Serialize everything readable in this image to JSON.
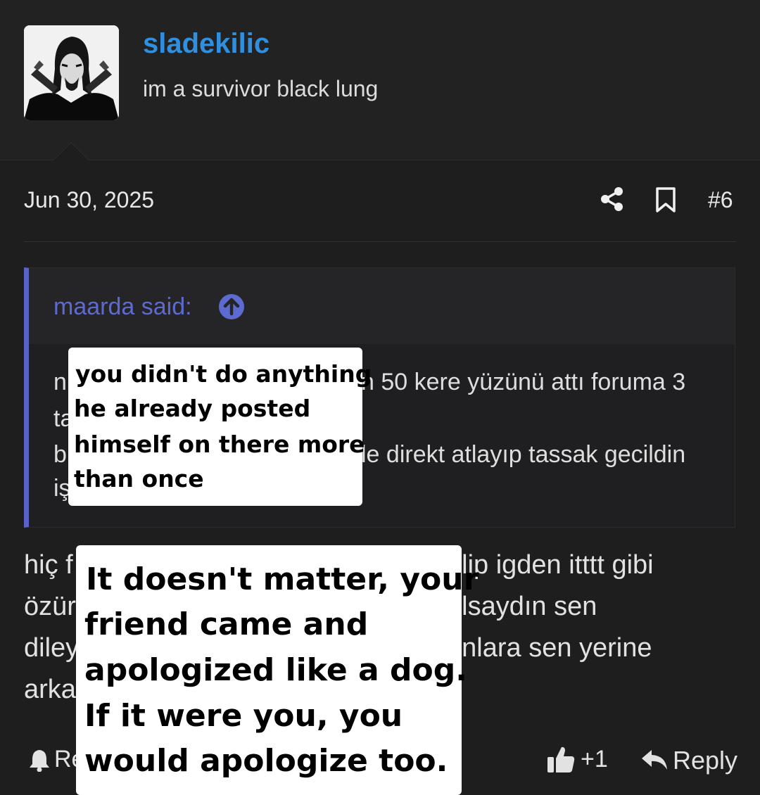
{
  "user": {
    "username": "sladekilic",
    "title": "im a survivor black lung"
  },
  "post": {
    "date": "Jun 30, 2025",
    "number": "#6",
    "icons": [
      "share-icon",
      "bookmark-icon"
    ]
  },
  "quote": {
    "attribution": "maarda said:",
    "visible_fragments": [
      "n",
      "n 50 kere yüzünü attı foruma 3",
      "ta",
      "b",
      "le direkt atlayıp tassak gecildin",
      "iş"
    ]
  },
  "message": {
    "visible_fragments": [
      "hiç f",
      "elip igden itttt gibi",
      "özür",
      "olsaydın sen",
      "diley",
      "unlara sen yerine",
      "arka"
    ]
  },
  "actions": {
    "report_partial": "Re",
    "like_count": "+1",
    "reply": "Reply"
  },
  "overlays": {
    "top": [
      "you didn't do anything",
      "he already posted",
      "himself on there more",
      "than once"
    ],
    "bottom": [
      "It doesn't matter, your",
      "friend came and",
      "apologized like a dog.",
      "If it were you, you",
      "would apologize too."
    ]
  },
  "colors": {
    "background": "#1e1e1f",
    "username": "#2f8fe0",
    "quote_accent": "#5a63c7",
    "quote_attribution": "#5d6bd1",
    "overlay_bg": "#ffffff"
  }
}
